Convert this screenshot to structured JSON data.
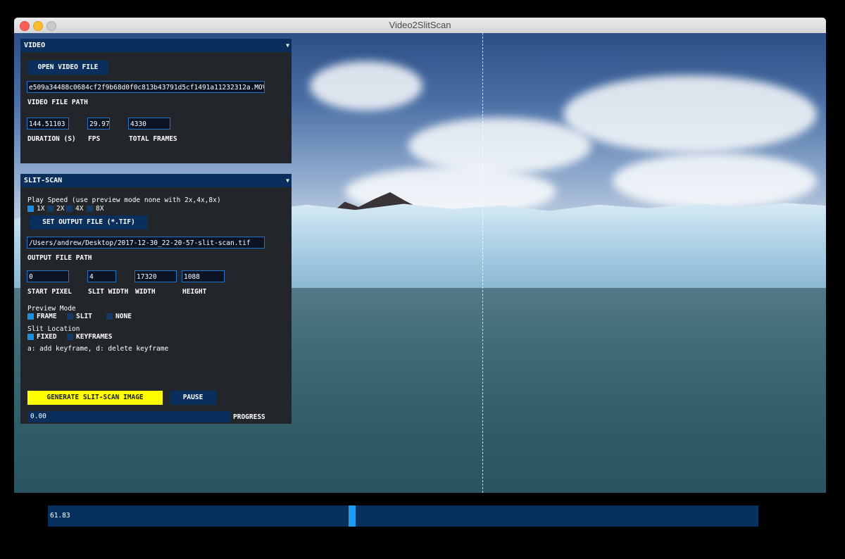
{
  "window": {
    "title": "Video2SlitScan"
  },
  "video_panel": {
    "header": "VIDEO",
    "open_button": "OPEN VIDEO FILE",
    "file_path_value": "e509a34488c0684cf2f9b68d0f0c813b43791d5cf1491a11232312a.MOV",
    "file_path_label": "VIDEO FILE PATH",
    "duration_value": "144.51103",
    "duration_label": "DURATION (S)",
    "fps_value": "29.97",
    "fps_label": "FPS",
    "frames_value": "4330",
    "frames_label": "TOTAL FRAMES"
  },
  "slitscan_panel": {
    "header": "SLIT-SCAN",
    "play_speed_label": "Play Speed (use preview mode none with 2x,4x,8x)",
    "speeds": [
      {
        "label": "1X",
        "checked": true
      },
      {
        "label": "2X",
        "checked": false
      },
      {
        "label": "4X",
        "checked": false
      },
      {
        "label": "8X",
        "checked": false
      }
    ],
    "output_button": "SET OUTPUT FILE (*.TIF)",
    "output_path_value": "/Users/andrew/Desktop/2017-12-30_22-20-57-slit-scan.tif",
    "output_path_label": "OUTPUT FILE PATH",
    "start_pixel_value": "0",
    "start_pixel_label": "START PIXEL",
    "slit_width_value": "4",
    "slit_width_label": "SLIT WIDTH",
    "width_value": "17320",
    "width_label": "WIDTH",
    "height_value": "1088",
    "height_label": "HEIGHT",
    "preview_mode_label": "Preview Mode",
    "preview_modes": [
      {
        "label": "FRAME",
        "checked": true
      },
      {
        "label": "SLIT",
        "checked": false
      },
      {
        "label": "NONE",
        "checked": false
      }
    ],
    "slit_location_label": "Slit Location",
    "slit_locations": [
      {
        "label": "FIXED",
        "checked": true
      },
      {
        "label": "KEYFRAMES",
        "checked": false
      }
    ],
    "keyframe_hint": "a: add keyframe, d: delete keyframe",
    "generate_button": "GENERATE SLIT-SCAN IMAGE",
    "pause_button": "PAUSE",
    "progress_value": "0.00",
    "progress_label": "PROGRESS"
  },
  "timeline": {
    "value": "61.83",
    "fraction": 0.4278
  },
  "colors": {
    "panel_header": "#0a2f5c",
    "field_border": "#1e73c9",
    "generate_button": "#ffff00",
    "checkbox_on": "#1b8ee0",
    "scrubber_handle": "#1e9cf0"
  }
}
